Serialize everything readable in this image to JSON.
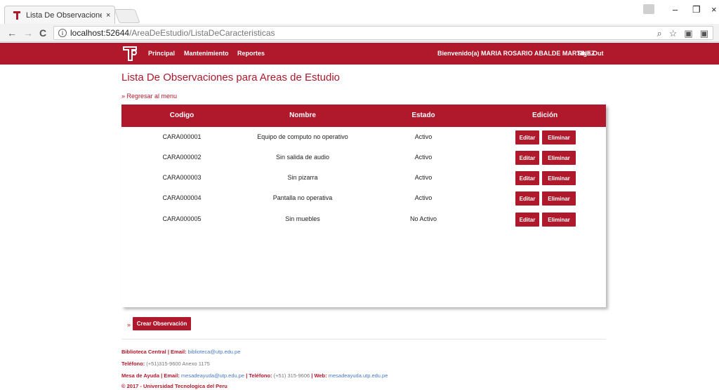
{
  "browser": {
    "tab_title": "Lista De Observaciones -",
    "tab_close": "×",
    "url_host": "localhost:52644",
    "url_path": "/AreaDeEstudio/ListaDeCaracteristicas",
    "win_minimize": "–",
    "win_restore": "❐",
    "win_close": "×",
    "nav_back": "←",
    "nav_forward": "→",
    "nav_reload": "C",
    "zoom_icon": "⌕",
    "star_icon": "☆"
  },
  "nav": {
    "links": [
      "Principal",
      "Mantenimiento",
      "Reportes"
    ],
    "welcome": "Bienvenido(a) MARIA ROSARIO ABALDE MARTINEZ",
    "sign_out": "Sign Out"
  },
  "page": {
    "title": "Lista De Observaciones para Areas de Estudio",
    "back_link": "» Regresar al menu"
  },
  "table": {
    "headers": [
      "Codigo",
      "Nombre",
      "Estado",
      "Edición"
    ],
    "rows": [
      {
        "codigo": "CARA000001",
        "nombre": "Equipo de computo no operativo",
        "estado": "Activo"
      },
      {
        "codigo": "CARA000002",
        "nombre": "Sin salida de audio",
        "estado": "Activo"
      },
      {
        "codigo": "CARA000003",
        "nombre": "Sin pizarra",
        "estado": "Activo"
      },
      {
        "codigo": "CARA000004",
        "nombre": "Pantalla no operativa",
        "estado": "Activo"
      },
      {
        "codigo": "CARA000005",
        "nombre": "Sin muebles",
        "estado": "No Activo"
      }
    ],
    "edit_label": "Editar",
    "delete_label": "Eliminar"
  },
  "actions": {
    "create_marker": "»",
    "create_label": "Crear Observación"
  },
  "footer": {
    "line1": {
      "lbl1": "Biblioteca Central | Email:",
      "email": "biblioteca@utp.edu.pe"
    },
    "line2": {
      "lbl": "Teléfono:",
      "val": "(+51)315-9600 Anexo 1175"
    },
    "line3": {
      "lbl1": "Mesa de Ayuda | Email:",
      "email": "mesadeayuda@utp.edu.pe",
      "lbl2": "| Teléfono:",
      "phone": "(+51) 315-9606",
      "lbl3": "| Web:",
      "web": "mesadeayuda.utp.edu.pe"
    },
    "line4": "© 2017 - Universidad Tecnologica del Peru"
  },
  "colors": {
    "brand": "#b0182b",
    "link_blue": "#4a78c2"
  }
}
